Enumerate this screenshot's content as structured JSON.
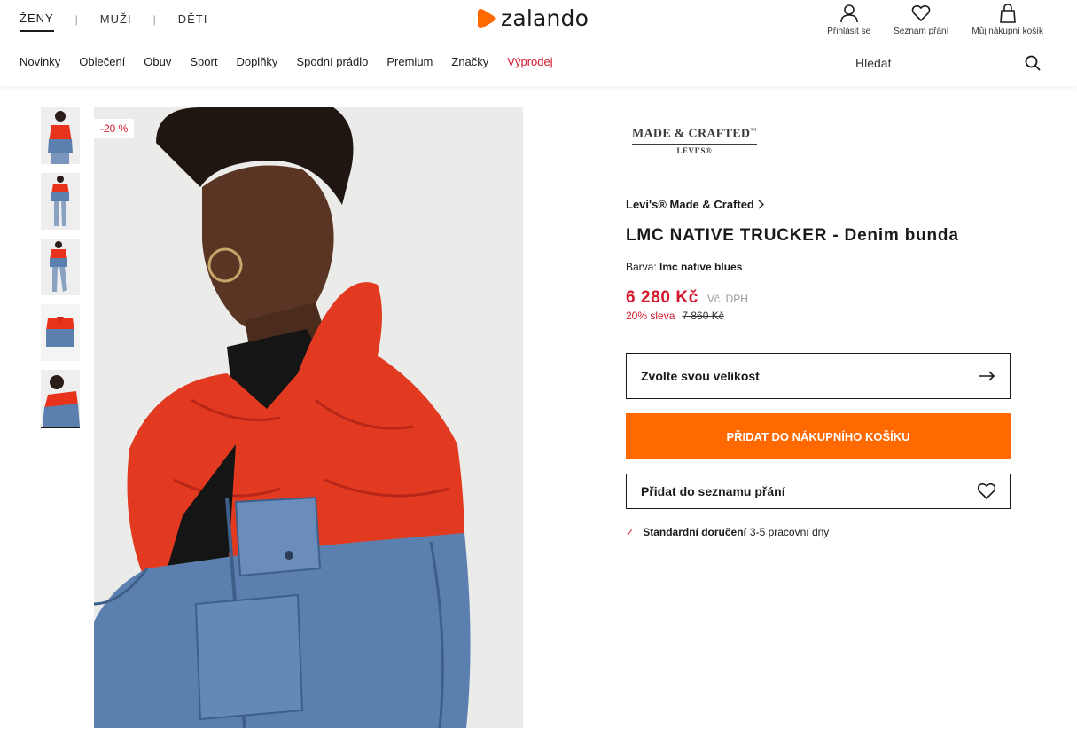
{
  "header": {
    "gender_nav": [
      "ŽENY",
      "MUŽI",
      "DĚTI"
    ],
    "logo_text": "zalando",
    "user_nav": {
      "login": "Přihlásit se",
      "wishlist": "Seznam přání",
      "cart": "Můj nákupní košík"
    },
    "categories": [
      "Novinky",
      "Oblečení",
      "Obuv",
      "Sport",
      "Doplňky",
      "Spodní prádlo",
      "Premium",
      "Značky",
      "Výprodej"
    ],
    "search_placeholder": "Hledat"
  },
  "gallery": {
    "badge": "-20 %",
    "thumbnail_count": 5,
    "active_thumbnail": 5
  },
  "product": {
    "brand_logo_line1": "MADE & CRAFTED",
    "brand_logo_tm": "™",
    "brand_logo_line2": "LEVI'S®",
    "brand": "Levi's® Made & Crafted",
    "title": "LMC NATIVE TRUCKER - Denim bunda",
    "color_label": "Barva:",
    "color_value": "lmc native blues",
    "price": "6 280 Kč",
    "vat": "Vč. DPH",
    "discount": "20% sleva",
    "old_price": "7 860 Kč",
    "size_button": "Zvolte svou velikost",
    "cart_button": "PŘIDAT DO NÁKUPNÍHO KOŠÍKU",
    "wishlist_button": "Přidat do seznamu přání",
    "delivery_label": "Standardní doručení",
    "delivery_time": "3-5 pracovní dny"
  },
  "colors": {
    "accent_orange": "#ff6900",
    "sale_red": "#d3182d",
    "text": "#1a1a1a"
  }
}
